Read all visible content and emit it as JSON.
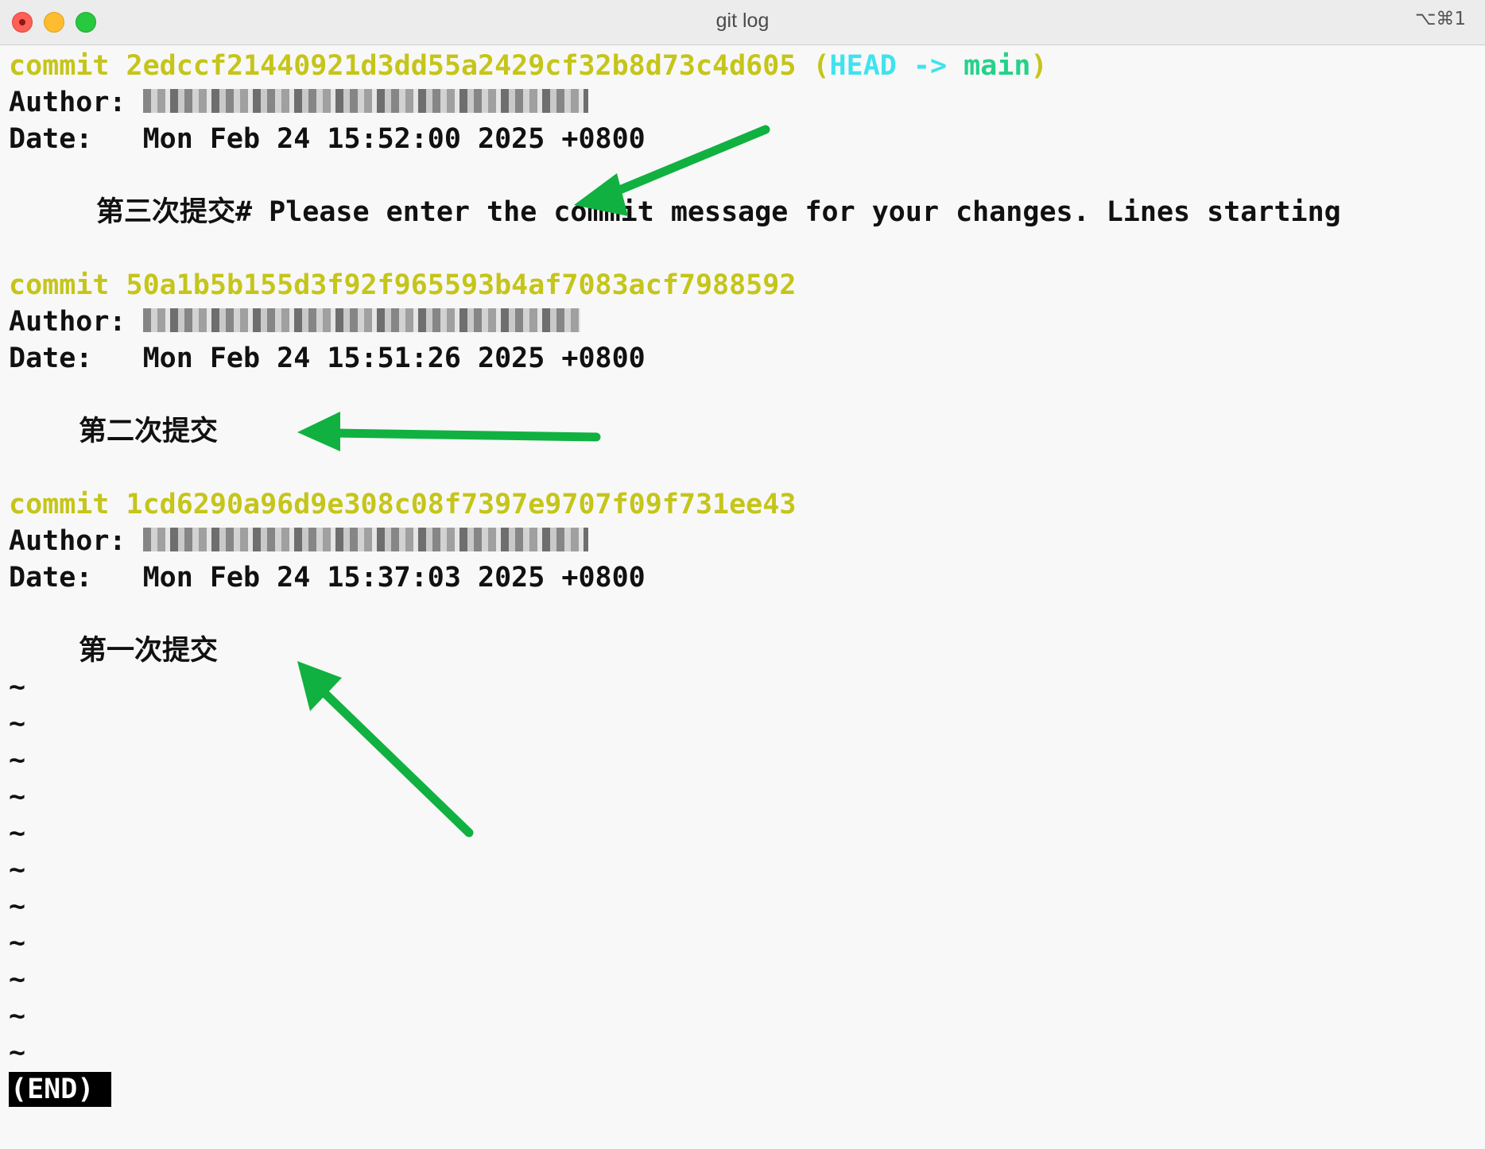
{
  "window": {
    "title": "git log",
    "shortcut": "⌥⌘1"
  },
  "commits": [
    {
      "commit_label": "commit",
      "hash": "2edccf21440921d3dd55a2429cf32b8d73c4d605",
      "ref_open": "(",
      "ref_head": "HEAD",
      "ref_arrow": "->",
      "ref_branch": "main",
      "ref_close": ")",
      "author_label": "Author:",
      "date_label": "Date:",
      "date": "Mon Feb 24 15:52:00 2025 +0800",
      "message": "第三次提交# Please enter the commit message for your changes. Lines starting"
    },
    {
      "commit_label": "commit",
      "hash": "50a1b5b155d3f92f965593b4af7083acf7988592",
      "author_label": "Author:",
      "date_label": "Date:",
      "date": "Mon Feb 24 15:51:26 2025 +0800",
      "message": "第二次提交"
    },
    {
      "commit_label": "commit",
      "hash": "1cd6290a96d9e308c08f7397e9707f09f731ee43",
      "author_label": "Author:",
      "date_label": "Date:",
      "date": "Mon Feb 24 15:37:03 2025 +0800",
      "message": "第一次提交"
    }
  ],
  "filler": {
    "tilde": "~"
  },
  "pager": {
    "end": "(END)"
  },
  "colors": {
    "hash": "#c5c51a",
    "head": "#3ee3ee",
    "branch": "#25d18a",
    "arrow_annotation": "#10b140"
  }
}
